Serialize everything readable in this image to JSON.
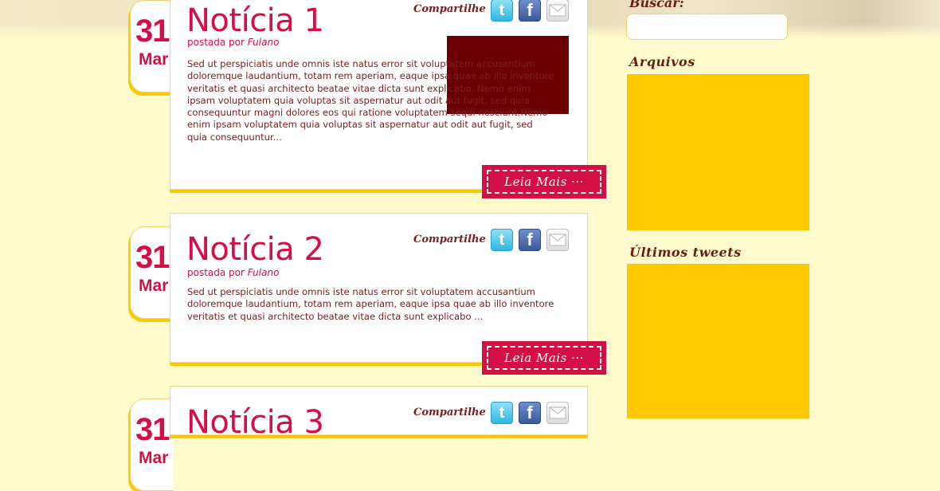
{
  "posts": [
    {
      "day": "31",
      "month": "Mar",
      "title": "Notícia 1",
      "byline_prefix": "postada por ",
      "author": "Fulano",
      "share_label": "Compartilhe",
      "excerpt": "Sed ut perspiciatis unde omnis iste natus error sit voluptatem accusantium doloremque laudantium, totam rem aperiam, eaque ipsa quae ab illo inventore veritatis et quasi architecto beatae vitae dicta sunt explicabo. Nemo enim ipsam voluptatem quia voluptas sit aspernatur aut odit aut fugit, sed quia consequuntur magni dolores eos qui ratione voluptatem sequi nesciunt.Nemo enim ipsam voluptatem quia voluptas sit aspernatur aut odit aut fugit, sed quia consequuntur...",
      "read_more": "Leia Mais ···"
    },
    {
      "day": "31",
      "month": "Mar",
      "title": "Notícia 2",
      "byline_prefix": "postada por ",
      "author": "Fulano",
      "share_label": "Compartilhe",
      "excerpt": "Sed ut perspiciatis unde omnis iste natus error sit voluptatem accusantium doloremque laudantium, totam rem aperiam, eaque ipsa quae ab illo inventore veritatis et quasi architecto beatae vitae dicta sunt explicabo ...",
      "read_more": "Leia Mais ···"
    },
    {
      "day": "31",
      "month": "Mar",
      "title": "Notícia 3",
      "share_label": "Compartilhe"
    }
  ],
  "share_icons": {
    "twitter": "t",
    "facebook": "f",
    "mail": "mail-icon"
  },
  "sidebar": {
    "search_label": "Buscar:",
    "search_placeholder": "",
    "archives_title": "Arquivos",
    "tweets_title": "Últimos tweets"
  },
  "colors": {
    "background": "#fffbcc",
    "accent": "#d40f45",
    "widget": "#ffc800",
    "image_placeholder": "#6a0004"
  }
}
